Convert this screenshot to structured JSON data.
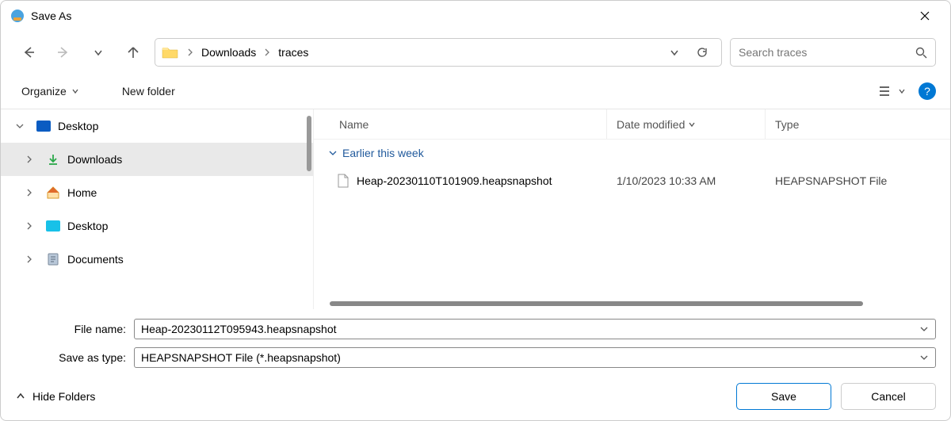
{
  "titlebar": {
    "title": "Save As"
  },
  "breadcrumb": {
    "items": [
      "Downloads",
      "traces"
    ]
  },
  "search": {
    "placeholder": "Search traces"
  },
  "toolbar": {
    "organize": "Organize",
    "new_folder": "New folder"
  },
  "sidebar": {
    "items": [
      {
        "label": "Desktop",
        "expanded": true,
        "icon": "desktop-blue",
        "level": 0
      },
      {
        "label": "Downloads",
        "expanded": false,
        "icon": "download",
        "level": 1,
        "selected": true
      },
      {
        "label": "Home",
        "expanded": false,
        "icon": "home",
        "level": 1
      },
      {
        "label": "Desktop",
        "expanded": false,
        "icon": "desktop-cyan",
        "level": 1
      },
      {
        "label": "Documents",
        "expanded": false,
        "icon": "documents",
        "level": 1
      }
    ]
  },
  "columns": {
    "name": "Name",
    "date": "Date modified",
    "type": "Type"
  },
  "groups": [
    {
      "label": "Earlier this week",
      "files": [
        {
          "name": "Heap-20230110T101909.heapsnapshot",
          "date": "1/10/2023 10:33 AM",
          "type": "HEAPSNAPSHOT File"
        }
      ]
    }
  ],
  "fields": {
    "filename_label": "File name:",
    "filename_value": "Heap-20230112T095943.heapsnapshot",
    "savetype_label": "Save as type:",
    "savetype_value": "HEAPSNAPSHOT File (*.heapsnapshot)"
  },
  "footer": {
    "hide_folders": "Hide Folders",
    "save": "Save",
    "cancel": "Cancel"
  }
}
